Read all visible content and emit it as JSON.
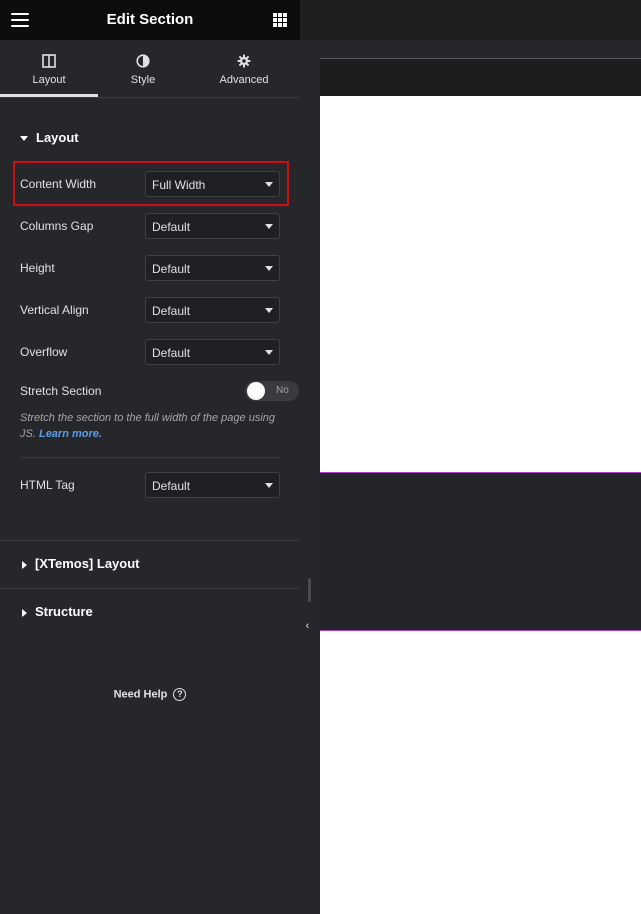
{
  "header": {
    "title": "Edit Section"
  },
  "tabs": [
    {
      "label": "Layout",
      "icon": "columns-icon",
      "active": true
    },
    {
      "label": "Style",
      "icon": "contrast-icon",
      "active": false
    },
    {
      "label": "Advanced",
      "icon": "gear-icon",
      "active": false
    }
  ],
  "layout_section": {
    "title": "Layout",
    "rows": [
      {
        "label": "Content Width",
        "value": "Full Width"
      },
      {
        "label": "Columns Gap",
        "value": "Default"
      },
      {
        "label": "Height",
        "value": "Default"
      },
      {
        "label": "Vertical Align",
        "value": "Default"
      },
      {
        "label": "Overflow",
        "value": "Default"
      }
    ],
    "stretch": {
      "label": "Stretch Section",
      "toggle_value": "No",
      "description": "Stretch the section to the full width of the page using JS.",
      "link": "Learn more."
    },
    "html_tag": {
      "label": "HTML Tag",
      "value": "Default"
    }
  },
  "collapsed_sections": [
    {
      "title": "[XTemos] Layout"
    },
    {
      "title": "Structure"
    }
  ],
  "help": {
    "label": "Need Help",
    "icon": "question-circle-icon"
  },
  "colors": {
    "highlight": "#d30b12",
    "section_outline": "#b13cc5",
    "link": "#5c9ee8"
  }
}
